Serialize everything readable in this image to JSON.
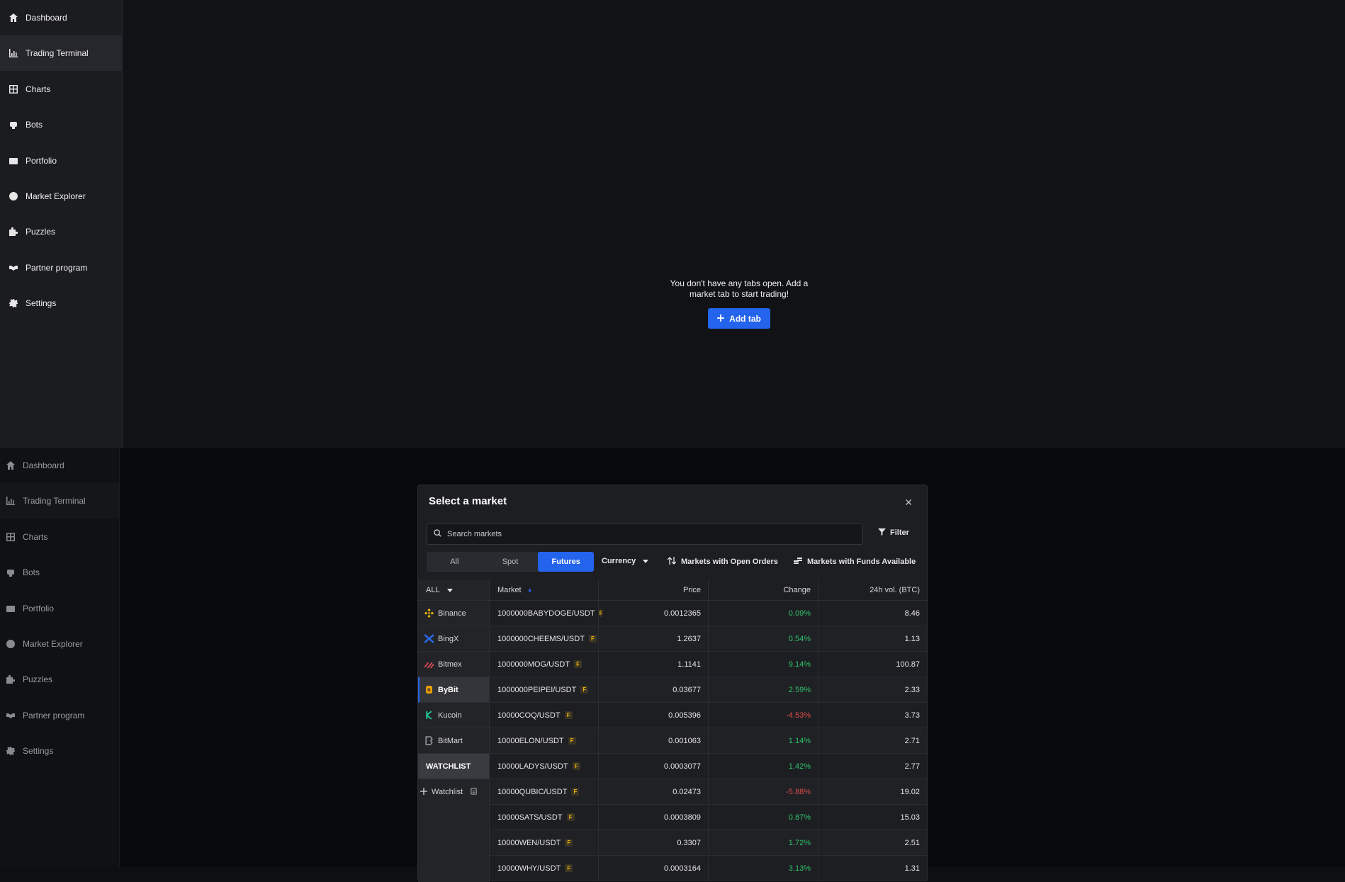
{
  "sidebar": {
    "items": [
      {
        "label": "Dashboard",
        "icon": "home-icon"
      },
      {
        "label": "Trading Terminal",
        "icon": "chart-icon"
      },
      {
        "label": "Charts",
        "icon": "grid-icon"
      },
      {
        "label": "Bots",
        "icon": "bot-icon"
      },
      {
        "label": "Portfolio",
        "icon": "wallet-icon"
      },
      {
        "label": "Market Explorer",
        "icon": "compass-icon"
      },
      {
        "label": "Puzzles",
        "icon": "puzzle-icon"
      },
      {
        "label": "Partner program",
        "icon": "handshake-icon"
      },
      {
        "label": "Settings",
        "icon": "gear-icon"
      }
    ],
    "active": "Trading Terminal"
  },
  "empty_state": {
    "message": "You don't have any tabs open. Add a market tab to start trading!",
    "button_label": "Add tab"
  },
  "modal": {
    "title": "Select a market",
    "search_placeholder": "Search markets",
    "filter_label": "Filter",
    "tabs": [
      "All",
      "Spot",
      "Futures"
    ],
    "active_tab": "Futures",
    "currency_label": "Currency",
    "open_orders_label": "Markets with Open Orders",
    "funds_label": "Markets with Funds Available",
    "exchange_filter": "ALL",
    "exchanges": [
      "Binance",
      "BingX",
      "Bitmex",
      "ByBit",
      "Kucoin",
      "BitMart"
    ],
    "active_exchange": "ByBit",
    "watchlist_header": "WATCHLIST",
    "watchlist_add": "Watchlist",
    "columns": {
      "market": "Market",
      "price": "Price",
      "change": "Change",
      "volume": "24h vol. (BTC)"
    },
    "rows": [
      {
        "market": "1000000BABYDOGE/USDT",
        "badge": "F",
        "price": "0.0012365",
        "change": "0.09%",
        "dir": "pos",
        "volume": "8.46"
      },
      {
        "market": "1000000CHEEMS/USDT",
        "badge": "F",
        "price": "1.2637",
        "change": "0.54%",
        "dir": "pos",
        "volume": "1.13"
      },
      {
        "market": "1000000MOG/USDT",
        "badge": "F",
        "price": "1.1141",
        "change": "9.14%",
        "dir": "pos",
        "volume": "100.87"
      },
      {
        "market": "1000000PEIPEI/USDT",
        "badge": "F",
        "price": "0.03677",
        "change": "2.59%",
        "dir": "pos",
        "volume": "2.33"
      },
      {
        "market": "10000COQ/USDT",
        "badge": "F",
        "price": "0.005396",
        "change": "-4.53%",
        "dir": "neg",
        "volume": "3.73"
      },
      {
        "market": "10000ELON/USDT",
        "badge": "F",
        "price": "0.001063",
        "change": "1.14%",
        "dir": "pos",
        "volume": "2.71"
      },
      {
        "market": "10000LADYS/USDT",
        "badge": "F",
        "price": "0.0003077",
        "change": "1.42%",
        "dir": "pos",
        "volume": "2.77"
      },
      {
        "market": "10000QUBIC/USDT",
        "badge": "F",
        "price": "0.02473",
        "change": "-5.88%",
        "dir": "neg",
        "volume": "19.02"
      },
      {
        "market": "10000SATS/USDT",
        "badge": "F",
        "price": "0.0003809",
        "change": "0.87%",
        "dir": "pos",
        "volume": "15.03"
      },
      {
        "market": "10000WEN/USDT",
        "badge": "F",
        "price": "0.3307",
        "change": "1.72%",
        "dir": "pos",
        "volume": "2.51"
      },
      {
        "market": "10000WHY/USDT",
        "badge": "F",
        "price": "0.0003164",
        "change": "3.13%",
        "dir": "pos",
        "volume": "1.31"
      }
    ]
  },
  "colors": {
    "accent": "#2463eb",
    "positive": "#2fc46b",
    "negative": "#e04c4c",
    "futures_badge": "#f0b90b"
  }
}
